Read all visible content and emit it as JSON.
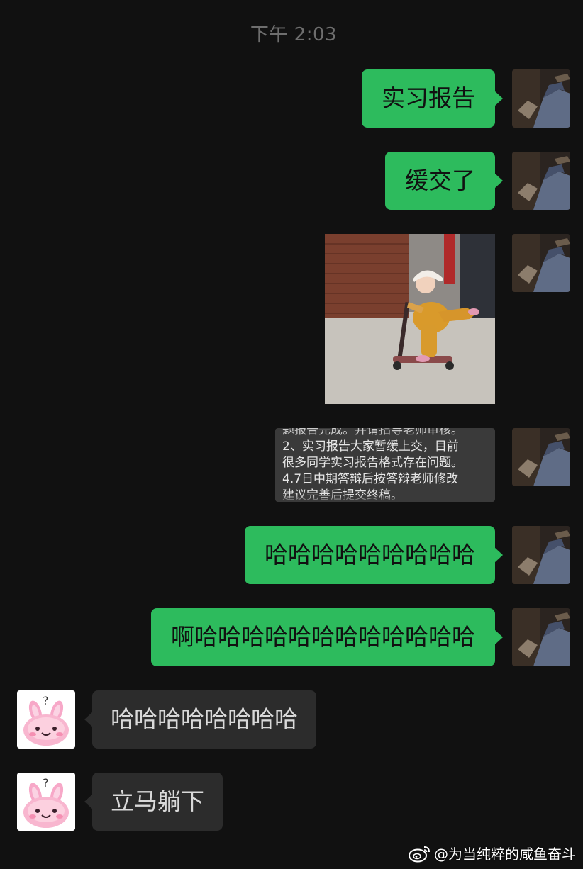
{
  "chat": {
    "timestamp": "下午 2:03",
    "messages": [
      {
        "sender": "self",
        "type": "text",
        "text": "实习报告"
      },
      {
        "sender": "self",
        "type": "text",
        "text": "缓交了"
      },
      {
        "sender": "self",
        "type": "image",
        "description_icon": "child-on-scooter-photo"
      },
      {
        "sender": "self",
        "type": "screenshot",
        "lines": [
          "题报告完成。并请指导老师审核。",
          "2、实习报告大家暂缓上交，目前",
          "很多同学实习报告格式存在问题。",
          "4.7日中期答辩后按答辩老师修改",
          "建议完善后提交终稿。"
        ]
      },
      {
        "sender": "self",
        "type": "text",
        "text": "哈哈哈哈哈哈哈哈哈"
      },
      {
        "sender": "self",
        "type": "text",
        "text": "啊哈哈哈哈哈哈哈哈哈哈哈哈"
      },
      {
        "sender": "other",
        "type": "text",
        "text": "哈哈哈哈哈哈哈哈"
      },
      {
        "sender": "other",
        "type": "text",
        "text": "立马躺下"
      }
    ]
  },
  "watermark": {
    "text": "@为当纯粹的咸鱼奋斗",
    "icon": "weibo-icon"
  },
  "colors": {
    "background": "#111111",
    "sent_bubble": "#2dbb5d",
    "received_bubble": "#2c2c2c",
    "timestamp": "#6e6e6e"
  },
  "icons": {
    "self_avatar": "dark-photo-avatar",
    "other_avatar": "pink-bunny-question-avatar"
  }
}
